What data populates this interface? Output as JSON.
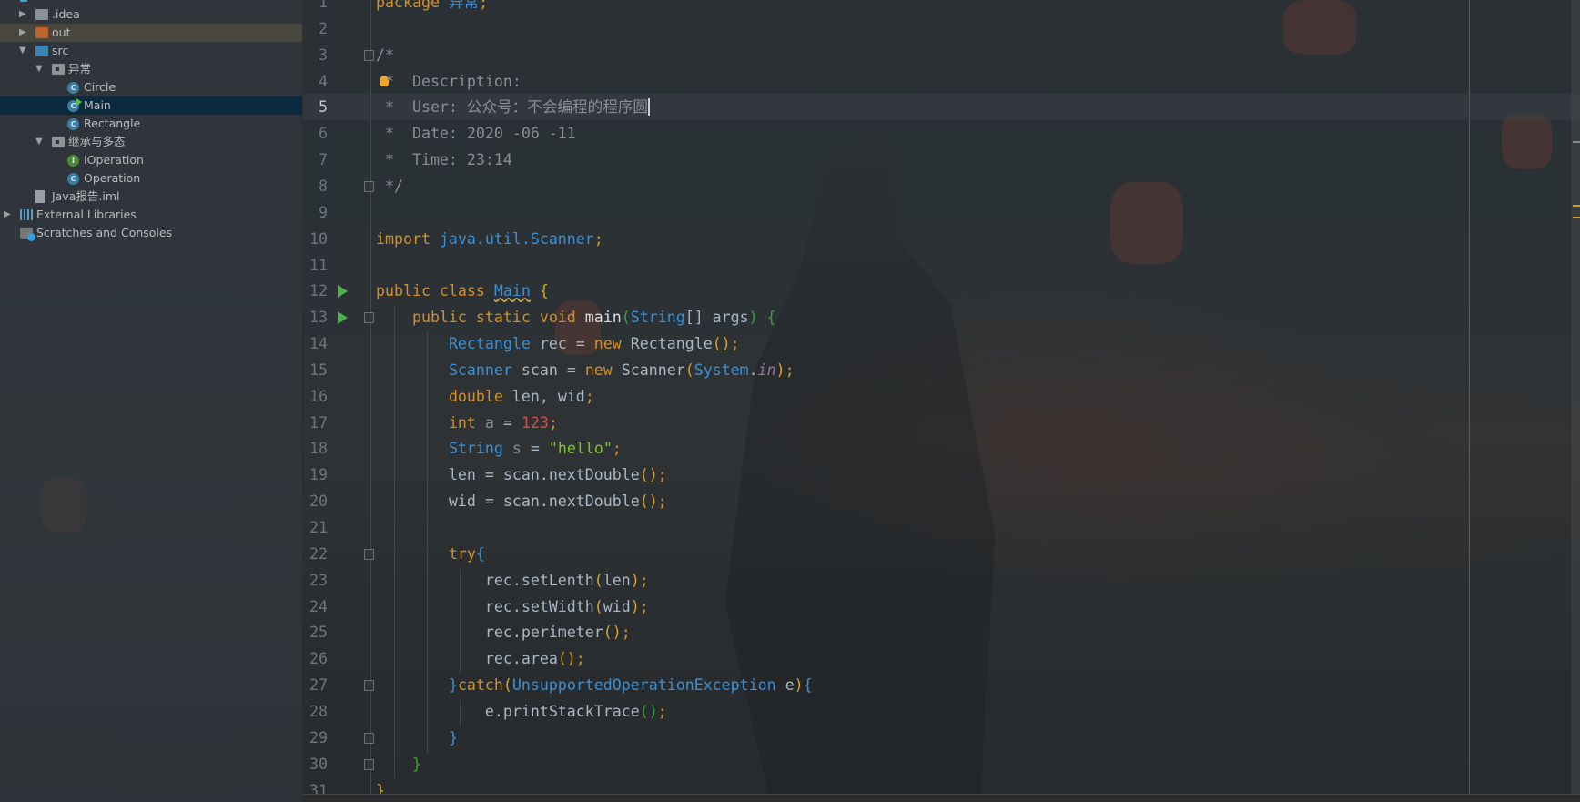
{
  "colors": {
    "keyword": "#d1902a",
    "type": "#3d8fd3",
    "comment": "#8a8f94",
    "string": "#7ec32b",
    "number": "#d0504a",
    "selection": "#0d293e"
  },
  "project_tree": [
    {
      "label": ".idea",
      "icon": "folder-icon",
      "depth": 1,
      "arrow": "collapsed",
      "color": "#8c9296"
    },
    {
      "label": "out",
      "icon": "folder-icon",
      "depth": 1,
      "arrow": "collapsed",
      "color": "#c0622b",
      "state": "highlighted"
    },
    {
      "label": "src",
      "icon": "folder-icon",
      "depth": 1,
      "arrow": "expanded",
      "color": "#3b84b0"
    },
    {
      "label": "异常",
      "icon": "package-icon",
      "depth": 2,
      "arrow": "expanded",
      "color": "#8c9296"
    },
    {
      "label": "Circle",
      "icon": "class-icon",
      "depth": 3,
      "badge": "C",
      "color": "#3a7fa3"
    },
    {
      "label": "Main",
      "icon": "class-run-icon",
      "depth": 3,
      "badge": "C",
      "color": "#3a7fa3",
      "state": "selected"
    },
    {
      "label": "Rectangle",
      "icon": "class-icon",
      "depth": 3,
      "badge": "C",
      "color": "#3a7fa3"
    },
    {
      "label": "继承与多态",
      "icon": "package-icon",
      "depth": 2,
      "arrow": "expanded",
      "color": "#8c9296"
    },
    {
      "label": "IOperation",
      "icon": "interface-icon",
      "depth": 3,
      "badge": "I",
      "color": "#4f8a3a"
    },
    {
      "label": "Operation",
      "icon": "class-icon",
      "depth": 3,
      "badge": "C",
      "color": "#3a7fa3"
    },
    {
      "label": "Java报告.iml",
      "icon": "file-icon",
      "depth": 1,
      "color": "#9a9ea2"
    },
    {
      "label": "External Libraries",
      "icon": "library-icon",
      "depth": 0,
      "arrow": "collapsed",
      "color": "#5b9bc8"
    },
    {
      "label": "Scratches and Consoles",
      "icon": "scratches-icon",
      "depth": 0,
      "color": "#5b9bc8"
    }
  ],
  "editor": {
    "current_line": 5,
    "lines": [
      [
        [
          "package ",
          "kw"
        ],
        [
          "异常",
          "pk"
        ],
        [
          ";",
          "kw"
        ]
      ],
      [],
      [
        [
          "/*",
          "cm"
        ]
      ],
      [
        [
          " *  Description:",
          "cm"
        ]
      ],
      [
        [
          " *  User: 公众号：不会编程的程序圆",
          "cm"
        ]
      ],
      [
        [
          " *  Date: 2020 -06 -11",
          "cm"
        ]
      ],
      [
        [
          " *  Time: 23:14",
          "cm"
        ]
      ],
      [
        [
          " */",
          "cm"
        ]
      ],
      [],
      [
        [
          "import ",
          "kw"
        ],
        [
          "java.util.Scanner",
          "pk"
        ],
        [
          ";",
          "kw"
        ]
      ],
      [],
      [
        [
          "public class ",
          "kw"
        ],
        [
          "Main",
          "ty squig"
        ],
        [
          " ",
          ""
        ],
        [
          "{",
          "p1"
        ]
      ],
      [
        [
          "    public static void ",
          "kw"
        ],
        [
          "main",
          "fn2"
        ],
        [
          "(",
          "p2"
        ],
        [
          "String",
          "ty"
        ],
        [
          "[] args",
          ""
        ],
        [
          ")",
          "p2"
        ],
        [
          " ",
          ""
        ],
        [
          "{",
          "p2"
        ]
      ],
      [
        [
          "        ",
          ""
        ],
        [
          "Rectangle",
          "ty"
        ],
        [
          " rec = ",
          ""
        ],
        [
          "new ",
          "kw"
        ],
        [
          "Rectangle",
          ""
        ],
        [
          "()",
          "p1"
        ],
        [
          ";",
          "kw"
        ]
      ],
      [
        [
          "        ",
          ""
        ],
        [
          "Scanner",
          "ty"
        ],
        [
          " scan = ",
          ""
        ],
        [
          "new ",
          "kw"
        ],
        [
          "Scanner",
          ""
        ],
        [
          "(",
          "p1"
        ],
        [
          "System",
          "ty"
        ],
        [
          ".",
          ""
        ],
        [
          "in",
          "it"
        ],
        [
          ")",
          "p1"
        ],
        [
          ";",
          "kw"
        ]
      ],
      [
        [
          "        ",
          ""
        ],
        [
          "double ",
          "kw"
        ],
        [
          "len, wid",
          ""
        ],
        [
          ";",
          "kw"
        ]
      ],
      [
        [
          "        ",
          ""
        ],
        [
          "int ",
          "kw"
        ],
        [
          "a",
          "gr"
        ],
        [
          " = ",
          ""
        ],
        [
          "123",
          "nm"
        ],
        [
          ";",
          "kw"
        ]
      ],
      [
        [
          "        ",
          ""
        ],
        [
          "String",
          "ty"
        ],
        [
          " ",
          ""
        ],
        [
          "s",
          "gr"
        ],
        [
          " = ",
          ""
        ],
        [
          "\"hello\"",
          "str"
        ],
        [
          ";",
          "kw"
        ]
      ],
      [
        [
          "        len = scan.nextDouble",
          ""
        ],
        [
          "()",
          "p1"
        ],
        [
          ";",
          "kw"
        ]
      ],
      [
        [
          "        wid = scan.nextDouble",
          ""
        ],
        [
          "()",
          "p1"
        ],
        [
          ";",
          "kw"
        ]
      ],
      [],
      [
        [
          "        ",
          ""
        ],
        [
          "try",
          "kw"
        ],
        [
          "{",
          "p3"
        ]
      ],
      [
        [
          "            rec.setLenth",
          ""
        ],
        [
          "(",
          "p1"
        ],
        [
          "len",
          ""
        ],
        [
          ")",
          "p1"
        ],
        [
          ";",
          "kw"
        ]
      ],
      [
        [
          "            rec.setWidth",
          ""
        ],
        [
          "(",
          "p1"
        ],
        [
          "wid",
          ""
        ],
        [
          ")",
          "p1"
        ],
        [
          ";",
          "kw"
        ]
      ],
      [
        [
          "            rec.perimeter",
          ""
        ],
        [
          "()",
          "p1"
        ],
        [
          ";",
          "kw"
        ]
      ],
      [
        [
          "            rec.area",
          ""
        ],
        [
          "()",
          "p1"
        ],
        [
          ";",
          "kw"
        ]
      ],
      [
        [
          "        ",
          ""
        ],
        [
          "}",
          "p3"
        ],
        [
          "catch",
          "kw"
        ],
        [
          "(",
          "p1"
        ],
        [
          "UnsupportedOperationException",
          "ty"
        ],
        [
          " e",
          ""
        ],
        [
          ")",
          "p1"
        ],
        [
          "{",
          "p3"
        ]
      ],
      [
        [
          "            e.printStackTrace",
          ""
        ],
        [
          "()",
          "p2"
        ],
        [
          ";",
          "kw"
        ]
      ],
      [
        [
          "        ",
          ""
        ],
        [
          "}",
          "p3"
        ]
      ],
      [
        [
          "    ",
          ""
        ],
        [
          "}",
          "p2"
        ]
      ],
      [
        [
          "}",
          "p1"
        ]
      ]
    ]
  }
}
